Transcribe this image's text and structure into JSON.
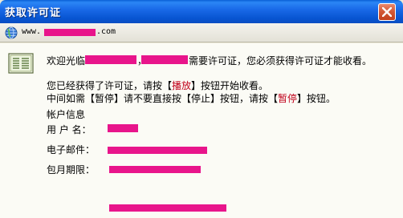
{
  "window": {
    "title": "获取许可证"
  },
  "urlbar": {
    "prefix": "www.",
    "suffix": ".com"
  },
  "message": {
    "welcome_prefix": "欢迎光临",
    "welcome_comma": "，",
    "welcome_suffix": "需要许可证，您必须获得许可证才能收看。",
    "line2_prefix": "您已经获得了许可证，请按【",
    "line2_play": "播放",
    "line2_suffix": "】按钮开始收看。",
    "line3_prefix": "中间如需【暂停】请不要直接按【停止】按钮，请按【",
    "line3_pause": "暂停",
    "line3_suffix": "】按钮。"
  },
  "account": {
    "heading": "帐户信息",
    "username_label": "用 户 名：",
    "email_label": "电子邮件：",
    "period_label": "包月期限："
  },
  "colors": {
    "redaction": "#e8158b",
    "title_blue": "#0a5fd6",
    "highlight_red": "#c0001a"
  }
}
